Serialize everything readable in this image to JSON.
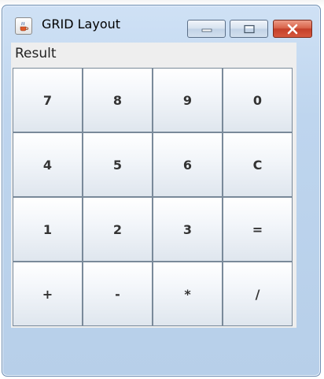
{
  "window": {
    "title": "GRID Layout",
    "icon": "java-cup-icon",
    "controls": [
      "minimize-icon",
      "maximize-icon",
      "close-icon"
    ]
  },
  "result_label": "Result",
  "keys": [
    [
      "7",
      "8",
      "9",
      "0"
    ],
    [
      "4",
      "5",
      "6",
      "C"
    ],
    [
      "1",
      "2",
      "3",
      "="
    ],
    [
      "+",
      "-",
      "*",
      "/"
    ]
  ],
  "colors": {
    "window_frame": "#bed5ee",
    "close_button": "#c4402a",
    "client_background": "#eeeeee"
  }
}
